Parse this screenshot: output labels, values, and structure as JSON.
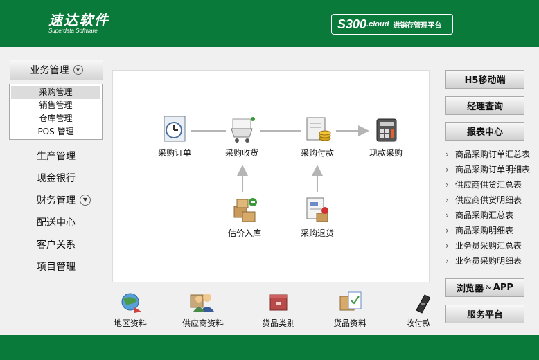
{
  "header": {
    "logo_main": "速达软件",
    "logo_sub": "Superdata Software",
    "product_s300": "S300",
    "product_cloud": ".cloud",
    "product_text": "进销存管理平台"
  },
  "left_nav": {
    "title": "业务管理",
    "submenu": [
      "采购管理",
      "销售管理",
      "仓库管理",
      "POS 管理"
    ],
    "items": [
      "生产管理",
      "现金银行",
      "财务管理",
      "配送中心",
      "客户关系",
      "项目管理"
    ]
  },
  "flow": {
    "purchase_order": "采购订单",
    "purchase_receive": "采购收货",
    "purchase_payment": "采购付款",
    "cash_purchase": "现款采购",
    "estimate_in": "估价入库",
    "purchase_return": "采购退货"
  },
  "shortcuts": [
    "地区资料",
    "供应商资料",
    "货品类别",
    "货品资料",
    "收付款"
  ],
  "right": {
    "btn_h5": "H5移动端",
    "btn_manager": "经理查询",
    "btn_report": "报表中心",
    "reports": [
      "商品采购订单汇总表",
      "商品采购订单明细表",
      "供应商供货汇总表",
      "供应商供货明细表",
      "商品采购汇总表",
      "商品采购明细表",
      "业务员采购汇总表",
      "业务员采购明细表"
    ],
    "btn_browser": "浏览器",
    "btn_browser_amp": "&",
    "btn_browser_app": "APP",
    "btn_service": "服务平台"
  },
  "colors": {
    "brand_green": "#0a7a3a",
    "panel_bg": "#f0f0f0"
  }
}
